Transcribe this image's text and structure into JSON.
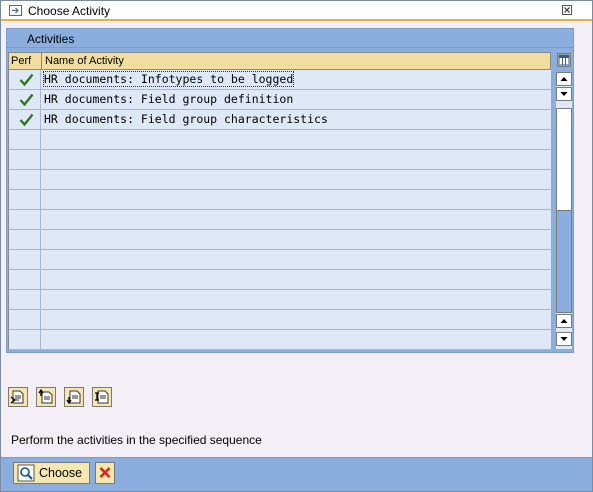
{
  "window": {
    "title": "Choose Activity"
  },
  "panel": {
    "title": "Activities"
  },
  "table": {
    "columns": [
      "Perf",
      "Name of Activity"
    ],
    "rows": [
      {
        "name": "HR documents: Infotypes to be logged",
        "performed": true
      },
      {
        "name": "HR documents: Field group definition",
        "performed": true
      },
      {
        "name": "HR documents: Field group characteristics",
        "performed": true
      }
    ],
    "empty_rows": 11
  },
  "toolbar": {
    "icons": [
      "detail-icon",
      "select-block-icon",
      "select-all-icon",
      "deselect-all-icon"
    ]
  },
  "hint": "Perform the activities in the specified sequence",
  "footer": {
    "choose_label": "Choose"
  },
  "colors": {
    "accent": "#8aaede",
    "header": "#f2dda0",
    "check": "#2f7a1a",
    "cancel": "#d8261a"
  }
}
